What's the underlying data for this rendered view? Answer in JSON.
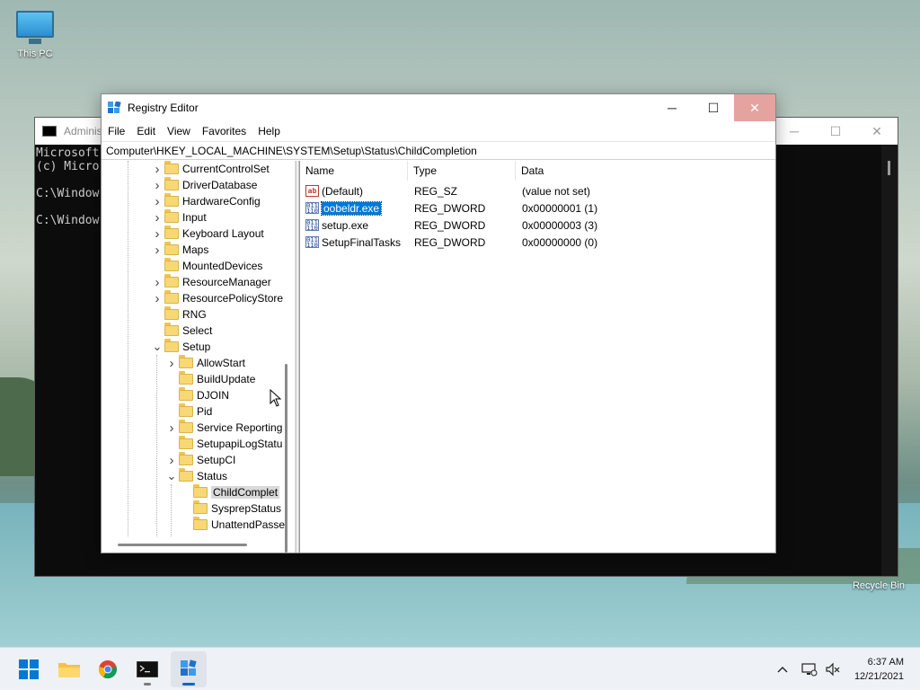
{
  "desktop": {
    "this_pc_label": "This PC",
    "recycle_bin_label": "Recycle Bin"
  },
  "cmd": {
    "title": "Adminis",
    "lines": [
      "Microsoft",
      "(c) Micro",
      "",
      "C:\\Window",
      "",
      "C:\\Window"
    ]
  },
  "regedit": {
    "title": "Registry Editor",
    "menu": [
      "File",
      "Edit",
      "View",
      "Favorites",
      "Help"
    ],
    "address": "Computer\\HKEY_LOCAL_MACHINE\\SYSTEM\\Setup\\Status\\ChildCompletion",
    "tree": [
      {
        "label": "CurrentControlSet",
        "chevron": "right"
      },
      {
        "label": "DriverDatabase",
        "chevron": "right"
      },
      {
        "label": "HardwareConfig",
        "chevron": "right"
      },
      {
        "label": "Input",
        "chevron": "right"
      },
      {
        "label": "Keyboard Layout",
        "chevron": "right"
      },
      {
        "label": "Maps",
        "chevron": "right"
      },
      {
        "label": "MountedDevices",
        "chevron": ""
      },
      {
        "label": "ResourceManager",
        "chevron": "right"
      },
      {
        "label": "ResourcePolicyStore",
        "chevron": "right"
      },
      {
        "label": "RNG",
        "chevron": ""
      },
      {
        "label": "Select",
        "chevron": ""
      },
      {
        "label": "Setup",
        "chevron": "down"
      },
      {
        "label": "AllowStart",
        "chevron": "right"
      },
      {
        "label": "BuildUpdate",
        "chevron": ""
      },
      {
        "label": "DJOIN",
        "chevron": ""
      },
      {
        "label": "Pid",
        "chevron": ""
      },
      {
        "label": "Service Reporting",
        "chevron": "right"
      },
      {
        "label": "SetupapiLogStatu",
        "chevron": ""
      },
      {
        "label": "SetupCI",
        "chevron": "right"
      },
      {
        "label": "Status",
        "chevron": "down"
      },
      {
        "label": "ChildComplet",
        "chevron": "",
        "selected": true
      },
      {
        "label": "SysprepStatus",
        "chevron": ""
      },
      {
        "label": "UnattendPasse",
        "chevron": ""
      }
    ],
    "columns": {
      "name": "Name",
      "type": "Type",
      "data": "Data"
    },
    "values": [
      {
        "icon": "string-value-icon",
        "name": "(Default)",
        "type": "REG_SZ",
        "data": "(value not set)"
      },
      {
        "icon": "dword-value-icon",
        "name": "oobeldr.exe",
        "type": "REG_DWORD",
        "data": "0x00000001 (1)",
        "selected": true
      },
      {
        "icon": "dword-value-icon",
        "name": "setup.exe",
        "type": "REG_DWORD",
        "data": "0x00000003 (3)"
      },
      {
        "icon": "dword-value-icon",
        "name": "SetupFinalTasks",
        "type": "REG_DWORD",
        "data": "0x00000000 (0)"
      }
    ],
    "controls": {
      "minimize": "─",
      "maximize": "☐",
      "close": "✕"
    }
  },
  "taskbar": {
    "apps": [
      "start-icon",
      "file-explorer-icon",
      "chrome-icon",
      "terminal-icon",
      "registry-editor-icon"
    ],
    "tray_overflow": "^",
    "time": "6:37 AM",
    "date": "12/21/2021"
  },
  "colors": {
    "accent": "#0078d7",
    "close_hover": "#e5a3a0",
    "folder": "#f8d775"
  }
}
